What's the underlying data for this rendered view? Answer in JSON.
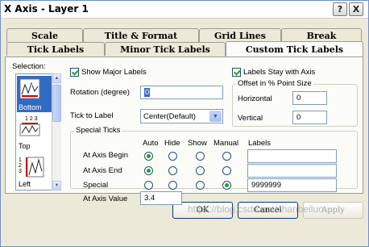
{
  "window": {
    "title": "X Axis - Layer 1",
    "help_glyph": "?",
    "close_glyph": "X"
  },
  "tabs_row1": [
    {
      "label": "Scale"
    },
    {
      "label": "Title & Format"
    },
    {
      "label": "Grid Lines"
    },
    {
      "label": "Break"
    }
  ],
  "tabs_row2": [
    {
      "label": "Tick Labels"
    },
    {
      "label": "Minor Tick Labels"
    },
    {
      "label": "Custom Tick Labels",
      "active": true
    }
  ],
  "selection": {
    "label": "Selection:",
    "items": [
      {
        "label": "Bottom",
        "icon": "bottom-axis-icon",
        "selected": true
      },
      {
        "label": "Top",
        "icon": "top-axis-icon"
      },
      {
        "label": "Left",
        "icon": "left-axis-icon"
      }
    ],
    "icon_digits": "1 2 3"
  },
  "options": {
    "show_major_labels": {
      "label": "Show Major Labels",
      "checked": true
    },
    "labels_stay_with_axis": {
      "label": "Labels Stay with Axis",
      "checked": true
    },
    "rotation_label": "Rotation (degree)",
    "rotation_value": "0",
    "tick_to_label": "Tick to Label",
    "tick_to_label_value": "Center(Default)"
  },
  "offset": {
    "title": "Offset in % Point Size",
    "horizontal_label": "Horizontal",
    "horizontal_value": "0",
    "vertical_label": "Vertical",
    "vertical_value": "0"
  },
  "special_ticks": {
    "title": "Special Ticks",
    "columns": [
      "Auto",
      "Hide",
      "Show",
      "Manual",
      "Labels"
    ],
    "rows": [
      {
        "label": "At Axis Begin",
        "selected": 0,
        "label_value": ""
      },
      {
        "label": "At Axis End",
        "selected": 0,
        "label_value": ""
      },
      {
        "label": "Special",
        "selected": 3,
        "label_value": "9999999"
      }
    ],
    "axis_value_label": "At Axis Value",
    "axis_value": "3.4"
  },
  "buttons": {
    "ok": "OK",
    "cancel": "Cancel",
    "apply": "Apply"
  },
  "watermark": "https://blog.csdn.net/zhanbeiluo"
}
